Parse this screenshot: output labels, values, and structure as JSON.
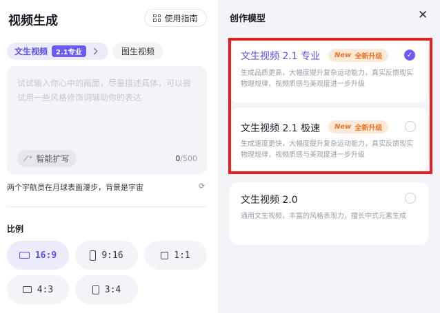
{
  "left": {
    "title": "视频生成",
    "guide_label": "使用指南",
    "tabs": {
      "text_to_video": "文生视频",
      "version_badge": "2.1专业",
      "image_to_video": "图生视频"
    },
    "prompt": {
      "placeholder": "试试输入你心中的画面，尽量描述具体，可以尝试用一些风格修饰词辅助你的表达",
      "expand_label": "智能扩写",
      "count": "0",
      "max": "/500"
    },
    "suggestion": "两个宇航员在月球表面漫步，背景是宇宙",
    "ratio": {
      "label": "比例",
      "options": [
        "16:9",
        "9:16",
        "1:1",
        "4:3",
        "3:4"
      ],
      "selected": "16:9"
    }
  },
  "panel": {
    "title": "创作模型",
    "close_symbol": "✕",
    "models": [
      {
        "name": "文生视频 2.1 专业",
        "tag_new": "New",
        "tag_text": "全新升级",
        "description": "生成品质更高，大幅度提升复杂运动能力，真实反馈现实物理规律，视频质感与美观度进一步升级",
        "selected": true
      },
      {
        "name": "文生视频 2.1 极速",
        "tag_new": "New",
        "tag_text": "全新升级",
        "description": "生成速度更快，大幅度提升复杂运动能力，真实反馈现实物理规律，视频质感与美观度进一步升级",
        "selected": false
      },
      {
        "name": "文生视频 2.0",
        "description": "通用文生视频，丰富的风格表现力，擅长中式元素生成",
        "selected": false
      }
    ]
  },
  "colors": {
    "accent": "#6a5cf0",
    "tag_orange": "#e8762c",
    "highlight": "#e81f1f"
  },
  "icons": {
    "guide": "grid-icon",
    "expand": "magic-wand-icon",
    "refresh": "refresh-icon",
    "close": "close-icon",
    "selected": "check-icon"
  }
}
